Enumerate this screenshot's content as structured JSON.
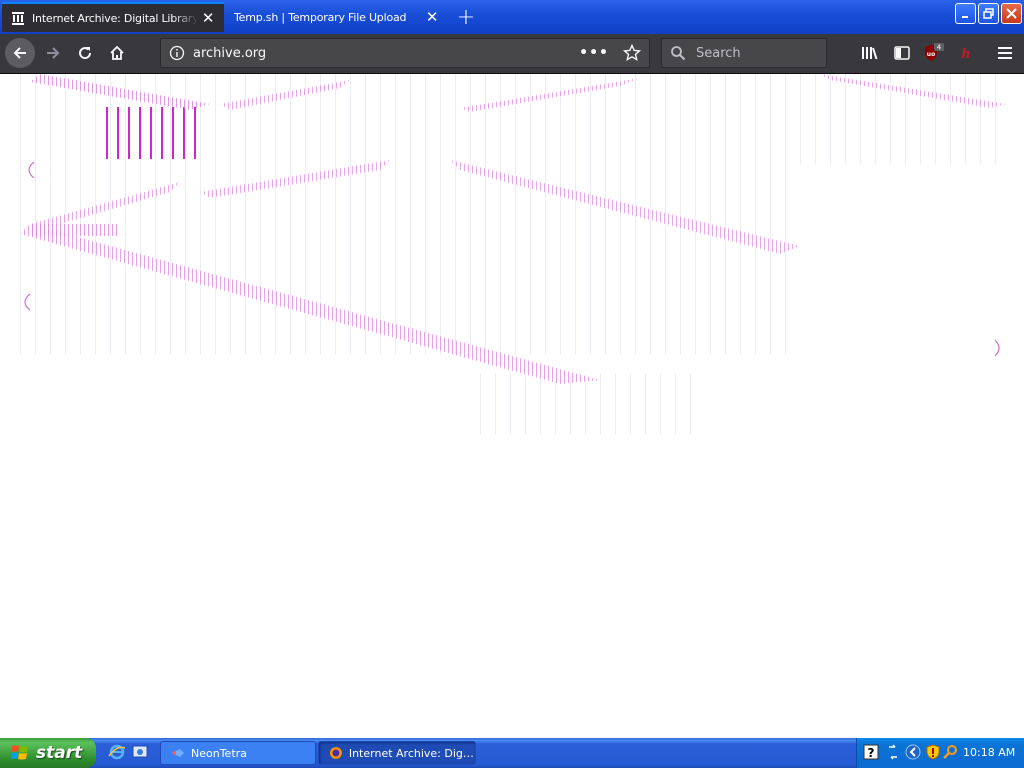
{
  "browser": {
    "tabs": [
      {
        "label": "Internet Archive: Digital Library of Free & Borrowable Books, Movies, Music & Wayback Machine",
        "active": true
      },
      {
        "label": "Temp.sh | Temporary File Upload",
        "active": false
      }
    ],
    "url": "archive.org",
    "search_placeholder": "Search",
    "ublock_badge": "4",
    "page_actions": "•••"
  },
  "taskbar": {
    "start_label": "start",
    "items": [
      {
        "label": "NeonTetra"
      },
      {
        "label": "Internet Archive: Digi..."
      }
    ],
    "clock": "10:18 AM"
  },
  "colors": {
    "toolbar": "#38383d",
    "active_tab_line": "#0a84ff",
    "xp_blue": "#245ad2",
    "start_green": "#3c9a3c",
    "glitch_magenta": "#c800c8"
  }
}
